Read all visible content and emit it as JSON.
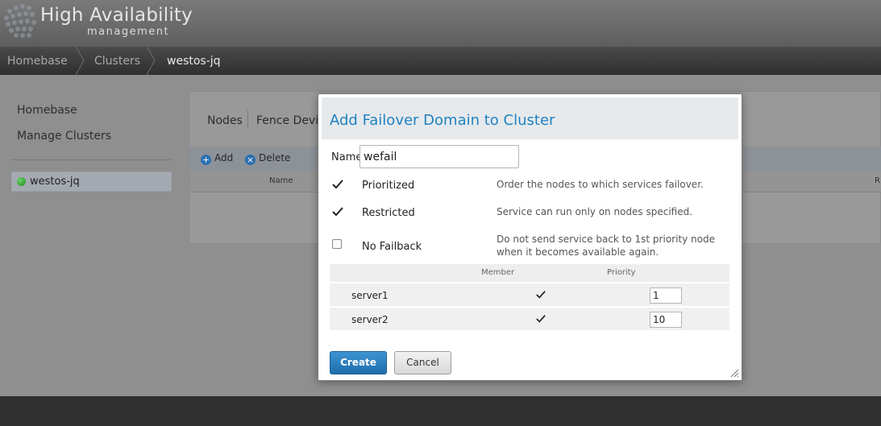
{
  "header": {
    "title": "High Availability",
    "subtitle": "management"
  },
  "breadcrumb": [
    "Homebase",
    "Clusters",
    "westos-jq"
  ],
  "sidebar": {
    "links": [
      "Homebase",
      "Manage Clusters"
    ],
    "cluster": {
      "name": "westos-jq",
      "status_color": "#2ea52e"
    }
  },
  "panel": {
    "tabs": [
      "Nodes",
      "Fence Devic"
    ],
    "toolbar": {
      "add": "Add",
      "delete": "Delete"
    },
    "columns": {
      "name": "Name",
      "right": "R"
    }
  },
  "dialog": {
    "title": "Add Failover Domain to Cluster",
    "name_label": "Name",
    "name_value": "wefail",
    "options": [
      {
        "label": "Prioritized",
        "checked": true,
        "description": "Order the nodes to which services failover."
      },
      {
        "label": "Restricted",
        "checked": true,
        "description": "Service can run only on nodes specified."
      },
      {
        "label": "No Failback",
        "checked": false,
        "description": "Do not send service back to 1st priority node when it becomes available again."
      }
    ],
    "table": {
      "headers": {
        "member": "Member",
        "priority": "Priority"
      },
      "rows": [
        {
          "node": "server1",
          "member": true,
          "priority": "1"
        },
        {
          "node": "server2",
          "member": true,
          "priority": "10"
        }
      ]
    },
    "create_label": "Create",
    "cancel_label": "Cancel",
    "accent_color": "#1f82c0"
  }
}
